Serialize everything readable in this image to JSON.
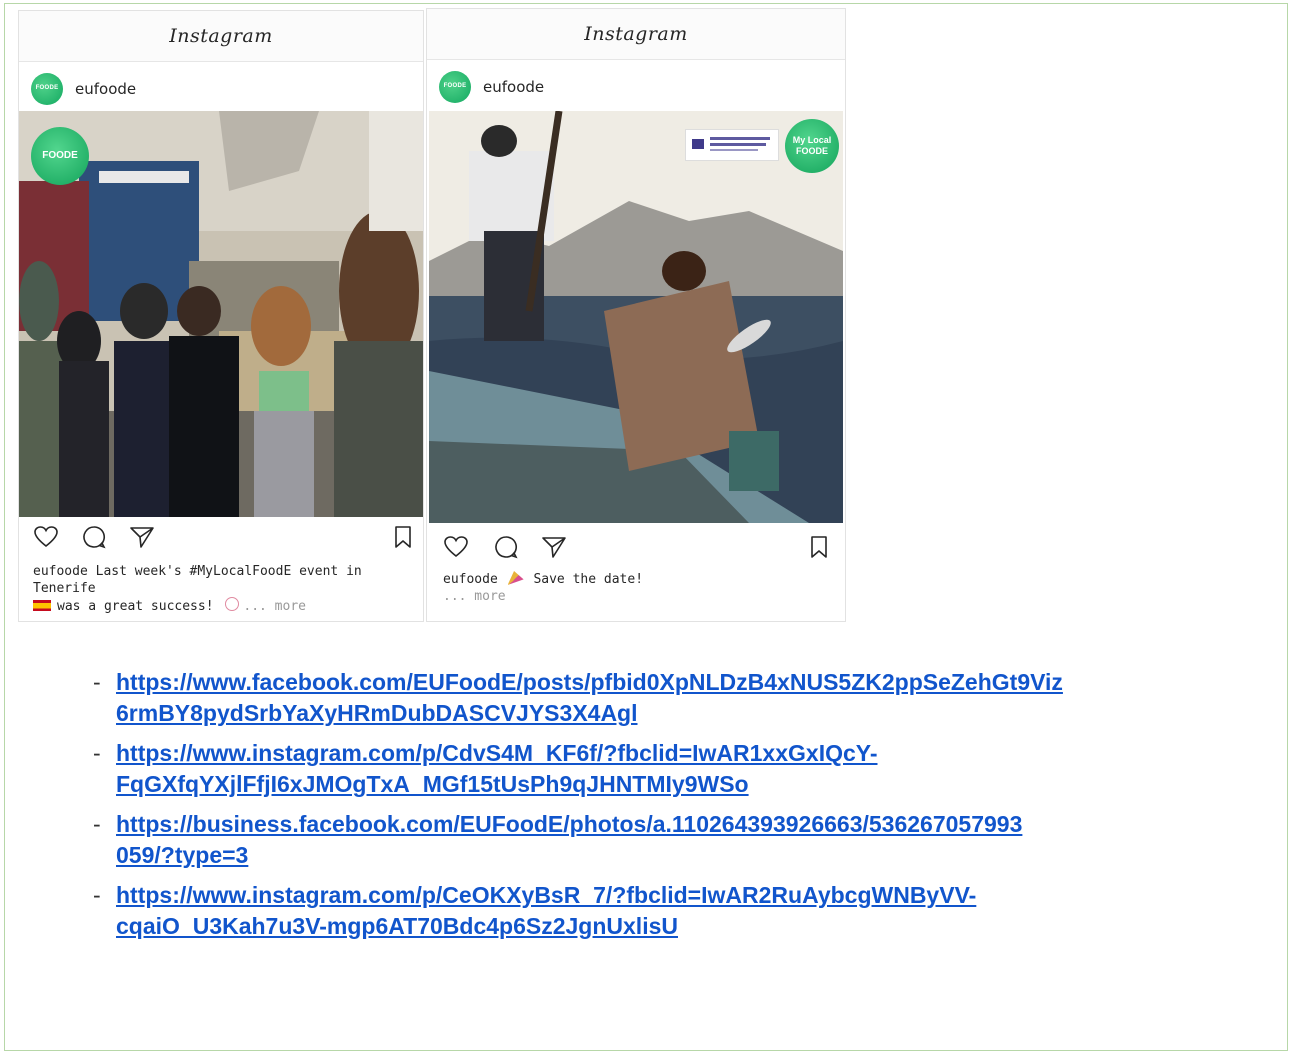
{
  "posts": [
    {
      "app_title": "Instagram",
      "username": "eufoode",
      "avatar_text": "FOODE",
      "photo_badge_text": "FOODE",
      "caption_lines": [
        "eufoode Last week's #MyLocalFoodE event in",
        "Tenerife",
        "was a great success!"
      ],
      "caption_more": "... more"
    },
    {
      "app_title": "Instagram",
      "username": "eufoode",
      "avatar_text": "FOODE",
      "photo_badge_text": "My Local FOODE",
      "caption_lines": [
        "eufoode",
        "Save the date!"
      ],
      "caption_more": "... more"
    }
  ],
  "icons": {
    "like": "heart-icon",
    "comment": "comment-icon",
    "share": "send-icon",
    "save": "bookmark-icon"
  },
  "links": [
    {
      "line1": "https://www.facebook.com/EUFoodE/posts/pfbid0XpNLDzB4xNUS5ZK2ppSeZehGt9Viz",
      "line2": "6rmBY8pydSrbYaXyHRmDubDASCVJYS3X4Agl"
    },
    {
      "line1": "https://www.instagram.com/p/CdvS4M_KF6f/?fbclid=IwAR1xxGxIQcY-",
      "line2": "FqGXfqYXjlFfjI6xJMOgTxA_MGf15tUsPh9qJHNTMIy9WSo"
    },
    {
      "line1": "https://business.facebook.com/EUFoodE/photos/a.110264393926663/536267057993",
      "line2": "059/?type=3"
    },
    {
      "line1": "https://www.instagram.com/p/CeOKXyBsR_7/?fbclid=IwAR2RuAybcgWNByVV-",
      "line2": "cqaiO_U3Kah7u3V-mgp6AT70Bdc4p6Sz2JgnUxlisU"
    }
  ],
  "colors": {
    "link": "#1155cc",
    "frame_border": "#b7d7a8",
    "brand_green": "#16a85e"
  }
}
